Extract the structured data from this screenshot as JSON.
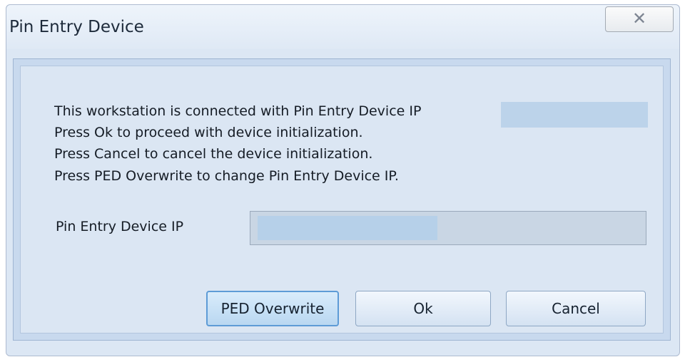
{
  "window": {
    "title": "Pin Entry Device",
    "close_glyph": "✕"
  },
  "message": {
    "line1": "This workstation is connected with Pin Entry Device IP",
    "line2": "Press Ok to proceed with device initialization.",
    "line3": "Press Cancel to cancel the device initialization.",
    "line4": "Press PED Overwrite to change Pin Entry Device IP."
  },
  "form": {
    "ip_label": "Pin Entry Device IP",
    "ip_value": ""
  },
  "buttons": {
    "ped_overwrite": "PED Overwrite",
    "ok": "Ok",
    "cancel": "Cancel"
  },
  "colors": {
    "dialog_bg": "#dbe6f3",
    "button_border": "#8ea7c4",
    "focus_border": "#5d9bd6"
  },
  "icons": {
    "close": "close-icon"
  }
}
